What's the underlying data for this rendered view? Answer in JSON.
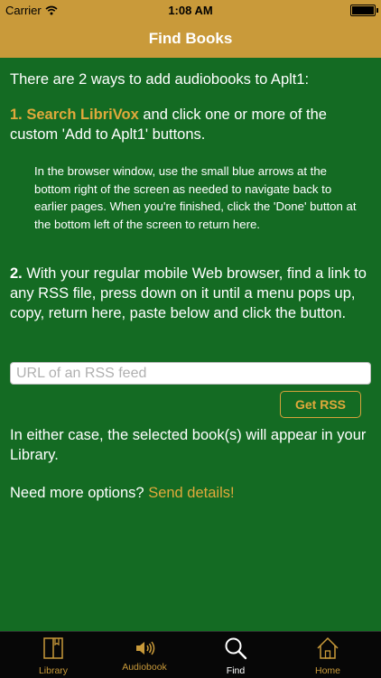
{
  "status_bar": {
    "carrier": "Carrier",
    "time": "1:08 AM"
  },
  "nav": {
    "title": "Find Books"
  },
  "content": {
    "intro": "There are 2 ways to add audiobooks to Aplt1:",
    "step1": {
      "number": "1.",
      "link": "Search LibriVox",
      "text": "and click one or more of the custom 'Add to Aplt1' buttons."
    },
    "note": "In the browser window, use the small blue arrows at the bottom right of the screen as needed to navigate back to earlier pages. When you're finished, click the 'Done' button at the bottom left of the screen to return here.",
    "step2": {
      "number": "2.",
      "text": "With your regular mobile Web browser, find a link to any RSS file, press down on it until a menu pops up, copy, return here, paste below and click the button."
    },
    "rss_input": {
      "value": "",
      "placeholder": "URL of an RSS feed"
    },
    "get_rss_label": "Get RSS",
    "result": "In either case, the selected book(s) will appear in your Library.",
    "more": {
      "text": "Need more options?",
      "link": "Send details!"
    }
  },
  "tabs": [
    {
      "label": "Library",
      "icon": "book-icon"
    },
    {
      "label": "Audiobook",
      "icon": "speaker-icon"
    },
    {
      "label": "Find",
      "icon": "magnifier-icon"
    },
    {
      "label": "Home",
      "icon": "house-icon"
    }
  ],
  "colors": {
    "background": "#146b23",
    "header": "#c99a3a",
    "link": "#e0a93b",
    "tab_bar": "#070707"
  }
}
